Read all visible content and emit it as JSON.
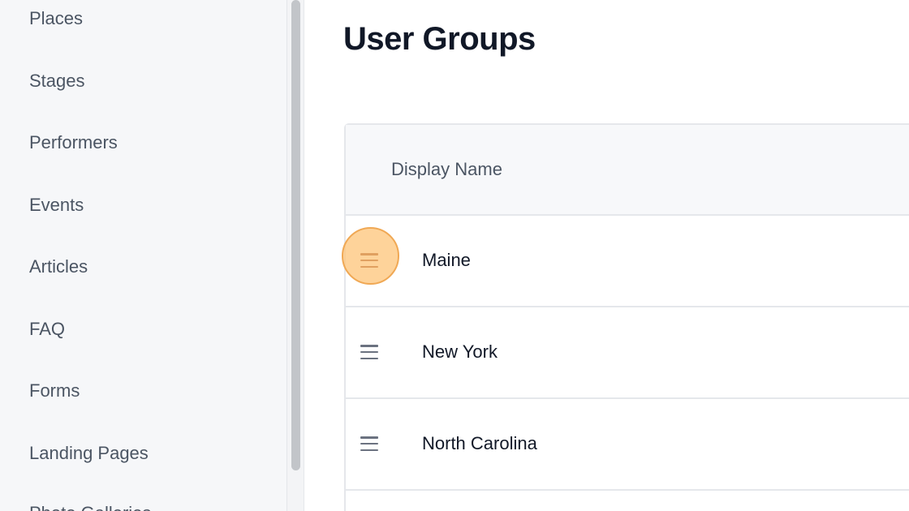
{
  "sidebar": {
    "items": [
      {
        "label": "Places"
      },
      {
        "label": "Stages"
      },
      {
        "label": "Performers"
      },
      {
        "label": "Events"
      },
      {
        "label": "Articles"
      },
      {
        "label": "FAQ"
      },
      {
        "label": "Forms"
      },
      {
        "label": "Landing Pages"
      },
      {
        "label": "Photo Galleries"
      }
    ]
  },
  "main": {
    "title": "User Groups",
    "table": {
      "columns": [
        "Display Name"
      ],
      "rows": [
        {
          "name": "Maine"
        },
        {
          "name": "New York"
        },
        {
          "name": "North Carolina"
        }
      ]
    }
  },
  "colors": {
    "highlight": "#fdc478",
    "sidebar_bg": "#f6f7f9",
    "header_bg": "#f7f8fa"
  },
  "icons": {
    "drag_handle": "drag-handle-icon"
  }
}
